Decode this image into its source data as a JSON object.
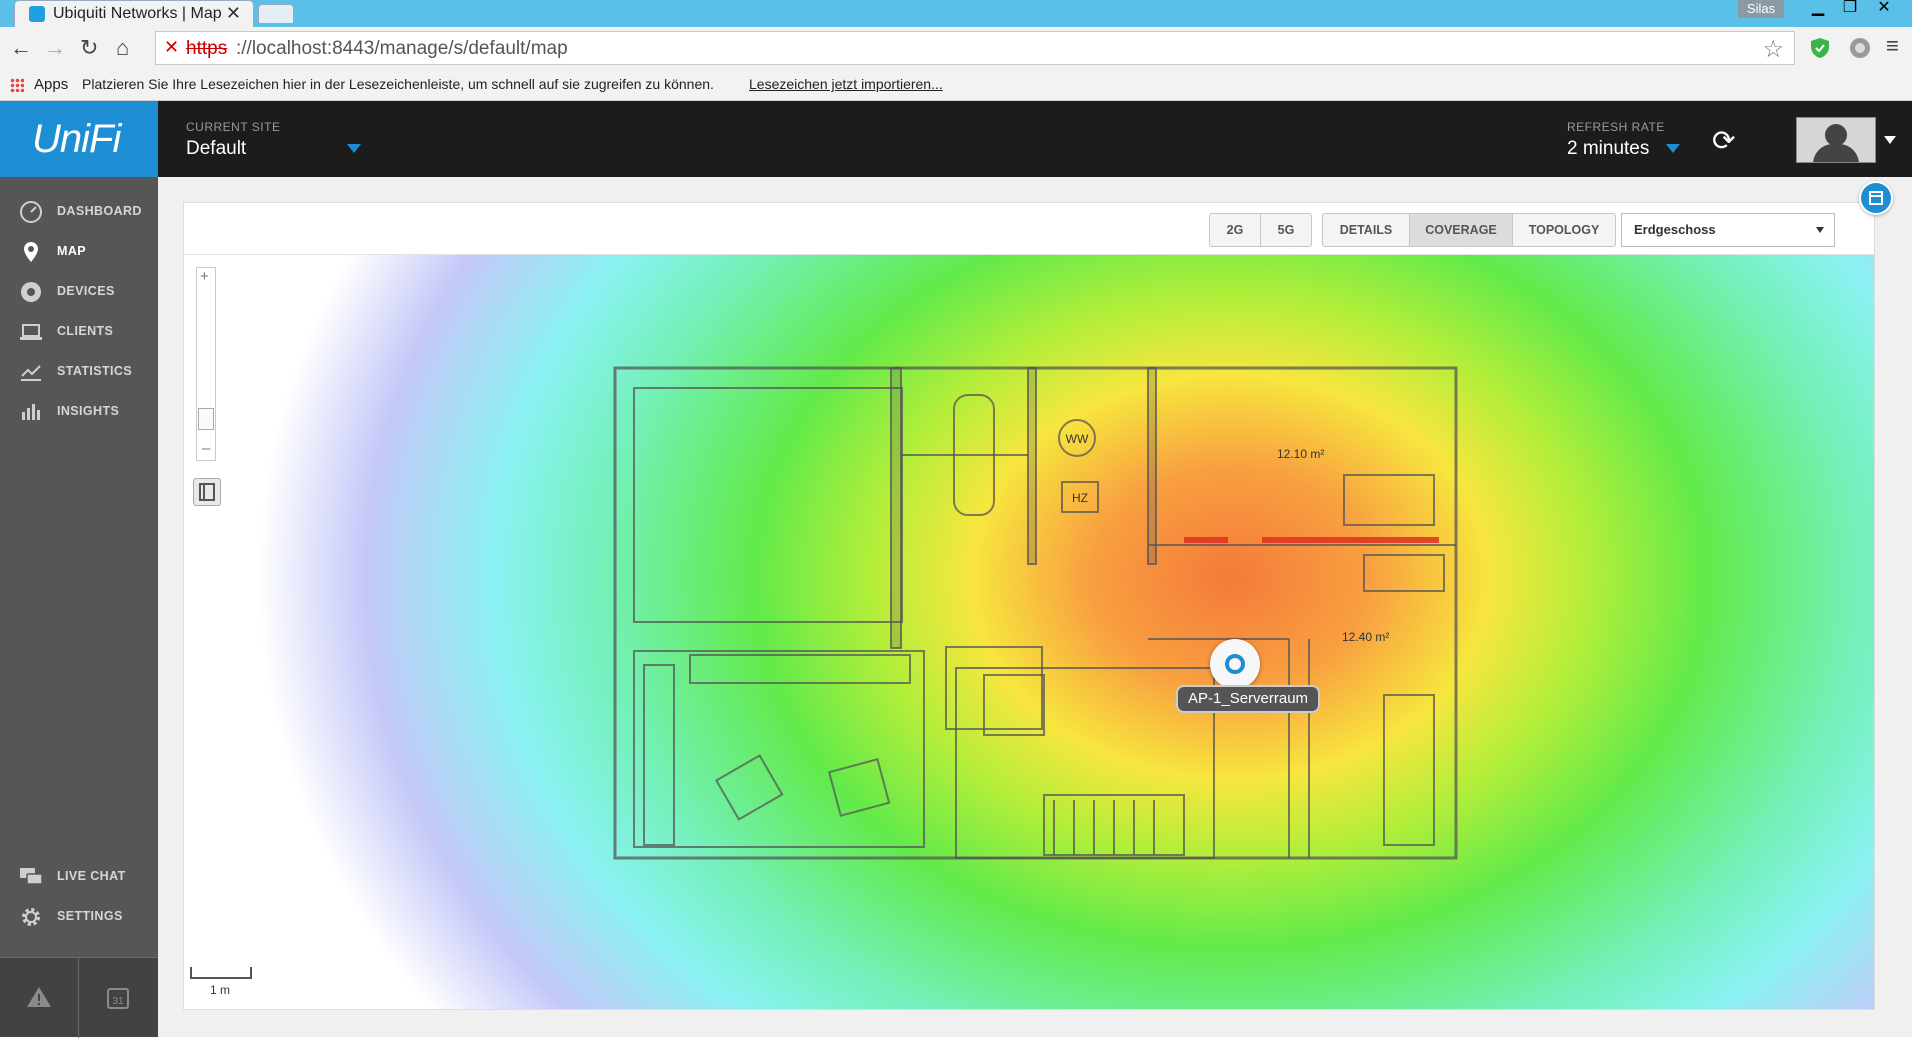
{
  "browser": {
    "tab_title": "Ubiquiti Networks | Map",
    "tab_close": "✕",
    "user": "Silas",
    "url_scheme": "https",
    "url_rest": "://localhost:8443/manage/s/default/map",
    "bookmarks": {
      "apps": "Apps",
      "hint": "Platzieren Sie Ihre Lesezeichen hier in der Lesezeichenleiste, um schnell auf sie zugreifen zu können.",
      "import": "Lesezeichen jetzt importieren..."
    }
  },
  "header": {
    "logo": "UniFi",
    "site_label": "CURRENT SITE",
    "site_name": "Default",
    "refresh_label": "REFRESH RATE",
    "refresh_value": "2 minutes"
  },
  "sidebar": {
    "items": [
      {
        "label": "DASHBOARD",
        "icon": "dashboard-icon"
      },
      {
        "label": "MAP",
        "icon": "map-pin-icon"
      },
      {
        "label": "DEVICES",
        "icon": "devices-icon"
      },
      {
        "label": "CLIENTS",
        "icon": "clients-icon"
      },
      {
        "label": "STATISTICS",
        "icon": "statistics-icon"
      },
      {
        "label": "INSIGHTS",
        "icon": "insights-icon"
      }
    ],
    "bottom": [
      {
        "label": "LIVE CHAT",
        "icon": "chat-icon"
      },
      {
        "label": "SETTINGS",
        "icon": "gear-icon"
      }
    ],
    "footer": {
      "calendar_day": "31"
    }
  },
  "map": {
    "bands": [
      "2G",
      "5G"
    ],
    "views": [
      "DETAILS",
      "COVERAGE",
      "TOPOLOGY"
    ],
    "active_view": "COVERAGE",
    "floor": "Erdgeschoss",
    "ap_name": "AP-1_Serverraum",
    "scale_label": "1 m",
    "floorplan_labels": {
      "ww": "WW",
      "hz": "HZ",
      "area1": "12.10 m²",
      "area2": "12.40 m²"
    }
  },
  "colors": {
    "accent": "#1e8ed4",
    "header_bg": "#1c1c1c",
    "sidebar_bg": "#565656",
    "titlebar": "#5bc0e8"
  }
}
